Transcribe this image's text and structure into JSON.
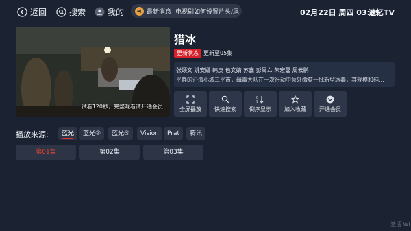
{
  "topbar": {
    "back_label": "返回",
    "search_label": "搜索",
    "mine_label": "我的",
    "notice_tag": "最新消息",
    "notice_text": "电视剧如何设置片头/尾",
    "datetime": "02月22日 周四 03:39",
    "brand": "追忆TV"
  },
  "video": {
    "trial_text": "试看120秒，完整观看请开通会员"
  },
  "detail": {
    "title": "猎冰",
    "status_badge": "更新状态",
    "update_text": "更新至05集",
    "cast": "张颂文 姚安娜 韩庚 包文婧 苏鑫 彭禺厶 朱宏嘉 周云鹏",
    "synopsis": "平静的沿海小城三平市，缉毒大队在一次行动中意外缴获一批新型冰毒，其规模和纯..."
  },
  "actions": [
    {
      "label": "全屏播放",
      "icon": "fullscreen-icon"
    },
    {
      "label": "快速搜索",
      "icon": "search-icon"
    },
    {
      "label": "倒序显示",
      "icon": "sort-icon"
    },
    {
      "label": "加入收藏",
      "icon": "star-icon"
    },
    {
      "label": "开通会员",
      "icon": "vip-icon"
    }
  ],
  "sources": {
    "label": "播放来源:",
    "items": [
      "蓝光",
      "蓝光②",
      "蓝光⑤",
      "Vision",
      "Prat",
      "腾讯"
    ],
    "active_index": 0
  },
  "episodes": {
    "items": [
      "第01集",
      "第02集",
      "第03集"
    ],
    "current_index": 0
  },
  "watermark": "激活 Wi",
  "colors": {
    "background": "#1b2333",
    "accent_red": "#e5322f",
    "tile": "#2c3446"
  }
}
